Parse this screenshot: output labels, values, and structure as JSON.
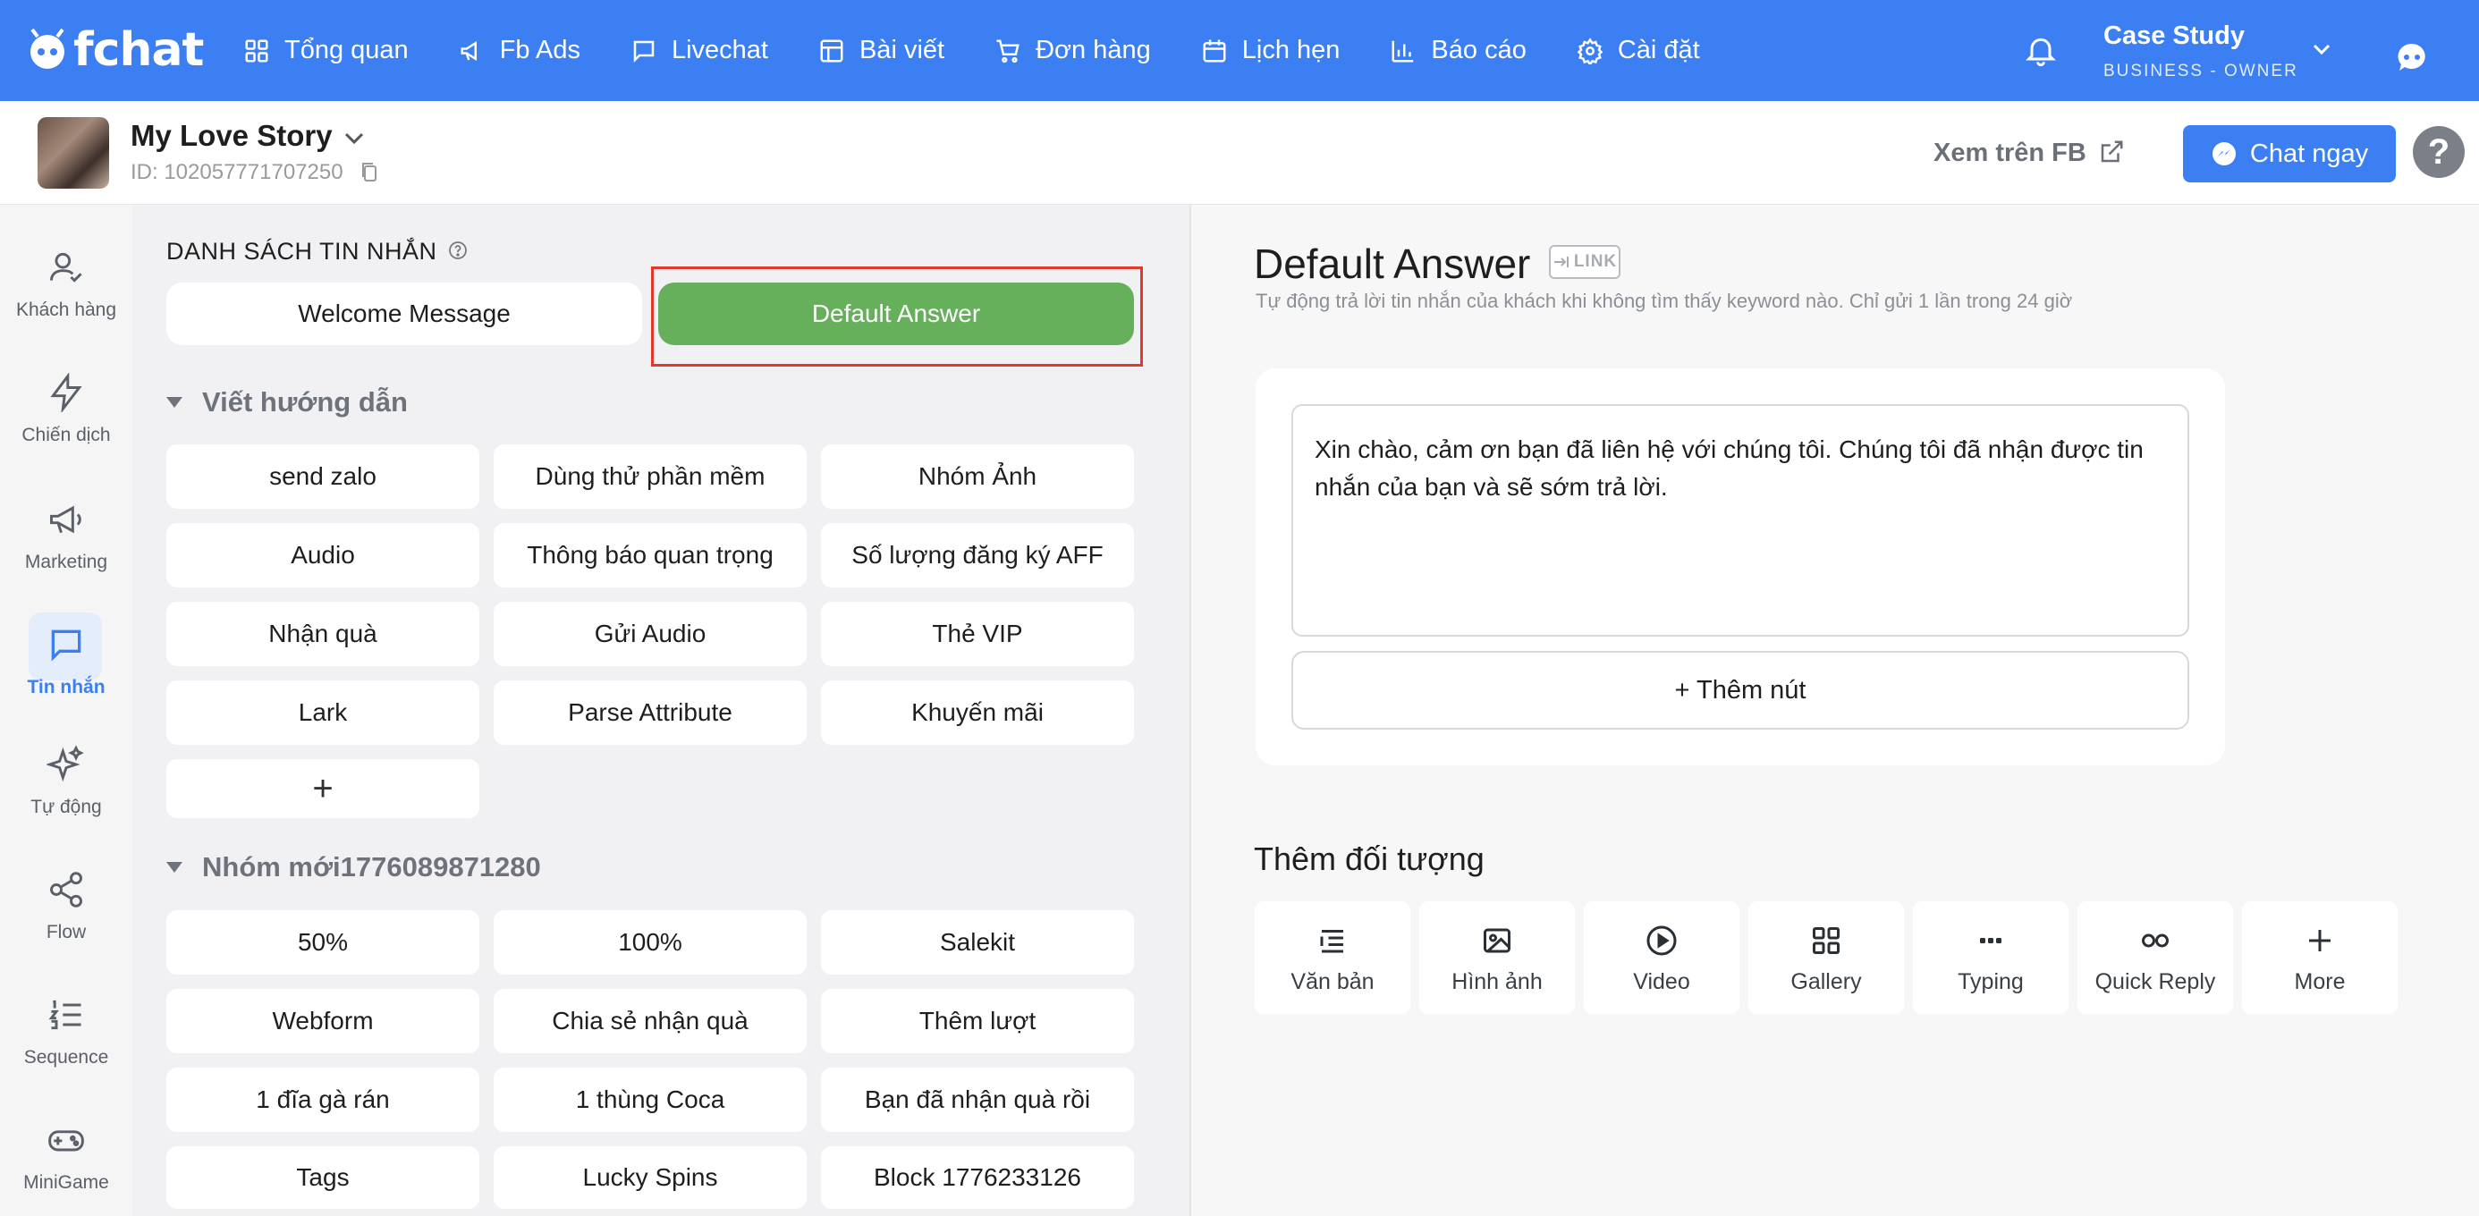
{
  "topnav": {
    "logo_text": "fchat",
    "items": [
      {
        "label": "Tổng quan",
        "icon": "dashboard-icon"
      },
      {
        "label": "Fb Ads",
        "icon": "megaphone-icon"
      },
      {
        "label": "Livechat",
        "icon": "chat-icon"
      },
      {
        "label": "Bài viết",
        "icon": "layout-icon"
      },
      {
        "label": "Đơn hàng",
        "icon": "cart-icon"
      },
      {
        "label": "Lịch hẹn",
        "icon": "calendar-icon"
      },
      {
        "label": "Báo cáo",
        "icon": "bar-chart-icon"
      },
      {
        "label": "Cài đặt",
        "icon": "gear-icon"
      }
    ],
    "account": {
      "name": "Case Study",
      "role": "BUSINESS - OWNER"
    }
  },
  "subheader": {
    "page_name": "My Love Story",
    "page_id": "ID: 102057771707250",
    "view_fb": "Xem trên FB",
    "chat_now": "Chat ngay",
    "help": "?"
  },
  "rail": {
    "items": [
      {
        "label": "Khách hàng",
        "icon": "user-check-icon"
      },
      {
        "label": "Chiến dịch",
        "icon": "lightning-icon"
      },
      {
        "label": "Marketing",
        "icon": "megaphone-icon"
      },
      {
        "label": "Tin nhắn",
        "icon": "message-icon",
        "active": true
      },
      {
        "label": "Tự động",
        "icon": "sparkle-icon"
      },
      {
        "label": "Flow",
        "icon": "share-icon"
      },
      {
        "label": "Sequence",
        "icon": "numbered-list-icon"
      },
      {
        "label": "MiniGame",
        "icon": "gamepad-icon"
      }
    ]
  },
  "messages": {
    "list_title": "DANH SÁCH TIN NHẮN",
    "tab_welcome": "Welcome Message",
    "tab_default": "Default Answer",
    "groups": [
      {
        "name": "Viết hướng dẫn",
        "items": [
          "send zalo",
          "Dùng thử phần mềm",
          "Nhóm Ảnh",
          "Audio",
          "Thông báo quan trọng",
          "Số lượng đăng ký AFF",
          "Nhận quà",
          "Gửi Audio",
          "Thẻ VIP",
          "Lark",
          "Parse Attribute",
          "Khuyến mãi"
        ],
        "add_label": "+"
      },
      {
        "name": "Nhóm mới1776089871280",
        "items": [
          "50%",
          "100%",
          "Salekit",
          "Webform",
          "Chia sẻ nhận quà",
          "Thêm lượt",
          "1 đĩa gà rán",
          "1 thùng Coca",
          "Bạn đã nhận quà rồi",
          "Tags",
          "Lucky Spins",
          "Block 1776233126"
        ]
      }
    ]
  },
  "editor": {
    "title": "Default Answer",
    "link_badge": "LINK",
    "subtitle": "Tự động trả lời tin nhắn của khách khi không tìm thấy keyword nào. Chỉ gửi 1 lần trong 24 giờ",
    "message_text": "Xin chào, cảm ơn bạn đã liên hệ với chúng tôi. Chúng tôi đã nhận được tin nhắn của bạn và sẽ sớm trả lời.",
    "add_button": "+ Thêm nút",
    "add_object_title": "Thêm đối tượng",
    "objects": [
      {
        "label": "Văn bản",
        "icon": "text-icon"
      },
      {
        "label": "Hình ảnh",
        "icon": "image-icon"
      },
      {
        "label": "Video",
        "icon": "play-icon"
      },
      {
        "label": "Gallery",
        "icon": "grid-icon"
      },
      {
        "label": "Typing",
        "icon": "dots-icon"
      },
      {
        "label": "Quick Reply",
        "icon": "quick-reply-icon"
      },
      {
        "label": "More",
        "icon": "plus-icon"
      }
    ]
  },
  "colors": {
    "primary": "#3b7ff3",
    "active_tab": "#66b05b",
    "highlight": "#e03a2f"
  }
}
